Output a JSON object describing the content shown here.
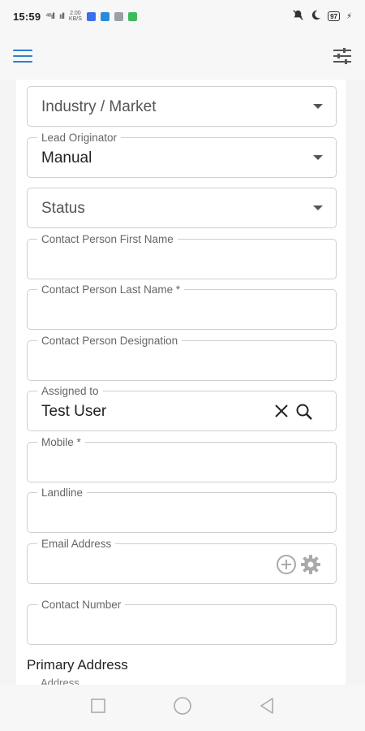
{
  "status_bar": {
    "time": "15:59",
    "signal1": "⁴⁶ıll",
    "signal2": "ııll",
    "net_speed": "2.00 KB/S",
    "battery": "97"
  },
  "form": {
    "industry_placeholder": "Industry / Market",
    "lead_originator_label": "Lead Originator",
    "lead_originator_value": "Manual",
    "status_placeholder": "Status",
    "contact_first_label": "Contact Person First Name",
    "contact_last_label": "Contact Person Last Name *",
    "designation_label": "Contact Person Designation",
    "assigned_label": "Assigned to",
    "assigned_value": "Test User",
    "mobile_label": "Mobile *",
    "landline_label": "Landline",
    "email_label": "Email Address",
    "contact_number_label": "Contact Number",
    "primary_address_title": "Primary Address",
    "address_label": "Address"
  },
  "colors": {
    "accent": "#2f7fd0",
    "border": "#cfcfcf"
  },
  "icons": {
    "menu": "hamburger-menu-icon",
    "filter": "sliders-icon",
    "clear": "close-icon",
    "search": "search-icon",
    "add": "add-circle-icon",
    "settings": "gear-icon"
  }
}
